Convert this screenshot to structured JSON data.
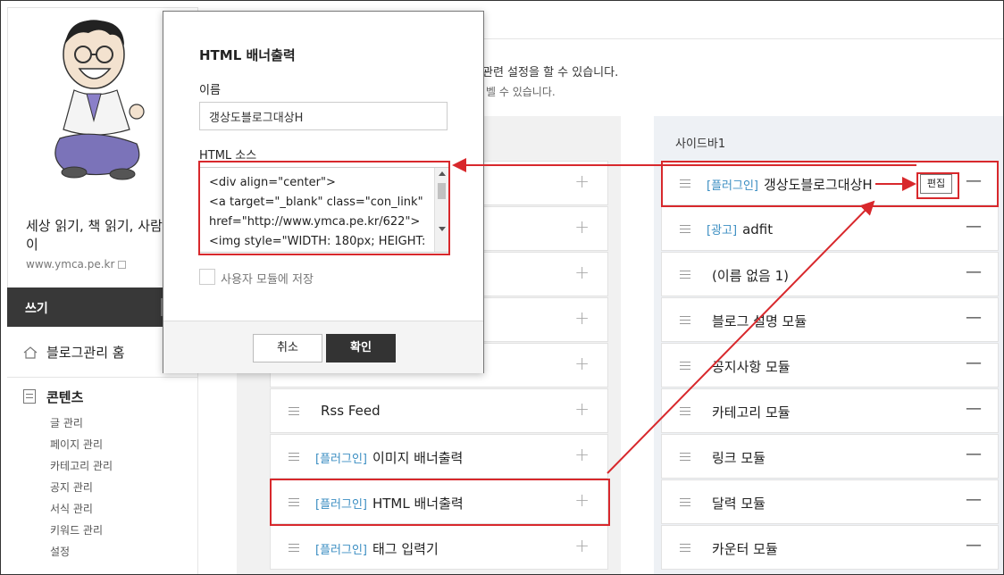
{
  "profile": {
    "blog_title_line1": "세상 읽기, 책 읽기, 사람 읽",
    "blog_title_line2": "이",
    "blog_url": "www.ymca.pe.kr"
  },
  "sidebar": {
    "write_label": "쓰기",
    "home_label": "블로그관리 홈",
    "contents_label": "콘텐츠",
    "submenu": [
      "글 관리",
      "페이지 관리",
      "카테고리 관리",
      "공지 관리",
      "서식 관리",
      "키워드 관리",
      "설정"
    ]
  },
  "main": {
    "desc1": "관련 설정을 할 수 있습니다.",
    "desc2": "벨 수 있습니다.",
    "right_column_label": "사이드바1"
  },
  "left_modules": [
    {
      "tag": "",
      "name": ""
    },
    {
      "tag": "",
      "name": ""
    },
    {
      "tag": "",
      "name": ""
    },
    {
      "tag": "",
      "name": ""
    },
    {
      "tag": "",
      "name": ""
    },
    {
      "tag": "",
      "name": "Rss Feed"
    },
    {
      "tag": "[플러그인]",
      "name": "이미지 배너출력"
    },
    {
      "tag": "[플러그인]",
      "name": "HTML 배너출력"
    },
    {
      "tag": "[플러그인]",
      "name": "태그 입력기"
    }
  ],
  "right_modules": [
    {
      "tag": "[플러그인]",
      "name": "갱상도블로그대상H"
    },
    {
      "tag": "[광고]",
      "name": "adfit"
    },
    {
      "tag": "",
      "name": "(이름 없음 1)"
    },
    {
      "tag": "",
      "name": "블로그 설명 모듈"
    },
    {
      "tag": "",
      "name": "공지사항 모듈"
    },
    {
      "tag": "",
      "name": "카테고리 모듈"
    },
    {
      "tag": "",
      "name": "링크 모듈"
    },
    {
      "tag": "",
      "name": "달력 모듈"
    },
    {
      "tag": "",
      "name": "카운터 모듈"
    }
  ],
  "edit_label": "편집",
  "dialog": {
    "title": "HTML 배너출력",
    "name_label": "이름",
    "name_value": "갱상도블로그대상H",
    "source_label": "HTML 소스",
    "source_lines": [
      "<div align=\"center\">",
      "<a target=\"_blank\" class=\"con_link\"",
      "href=\"http://www.ymca.pe.kr/622\">",
      "<img style=\"WIDTH: 180px; HEIGHT:"
    ],
    "save_module_label": "사용자 모듈에 저장",
    "cancel_label": "취소",
    "ok_label": "확인"
  },
  "colors": {
    "annotation_red": "#d8282c",
    "plugin_tag_blue": "#3b8ec2",
    "dark_button": "#333333"
  }
}
